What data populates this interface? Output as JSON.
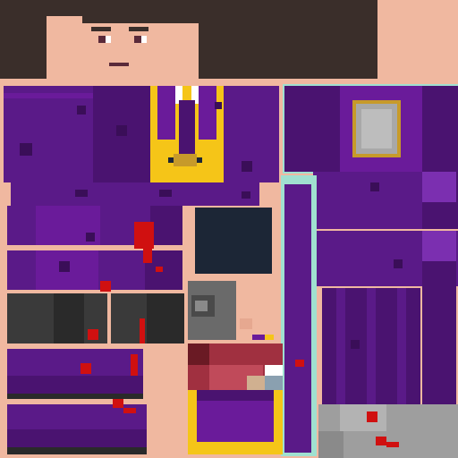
{
  "palette": {
    "skin": "#f0b8a0",
    "hair": "#3a2e2a",
    "purple_dark": "#4a1370",
    "purple_mid": "#6a1b9a",
    "purple_light": "#7b2fb0",
    "gold": "#f5c518",
    "navy": "#1c2636",
    "gray_dark": "#3a3a3a",
    "gray_light": "#9e9e9e",
    "blood": "#d01010"
  }
}
